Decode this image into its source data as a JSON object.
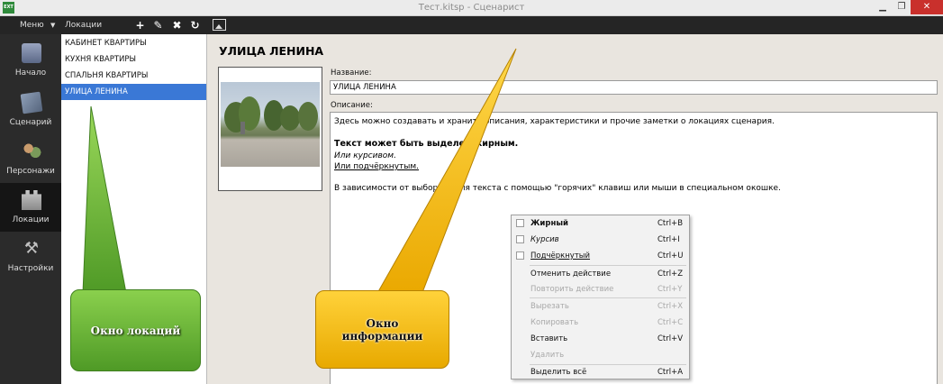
{
  "window": {
    "app_icon_text": "EXT",
    "title": "Тест.kitsp  - Сценарист",
    "min_glyph": "▁",
    "max_glyph": "❐",
    "close_glyph": "✕"
  },
  "menubar": {
    "menu_label": "Меню",
    "menu_caret": "▼",
    "panel_label": "Локации",
    "add_glyph": "+",
    "edit_glyph": "✎",
    "delete_glyph": "✖",
    "refresh_glyph": "↻"
  },
  "nav": {
    "items": [
      {
        "label": "Начало",
        "icon": "home-icon"
      },
      {
        "label": "Сценарий",
        "icon": "script-icon"
      },
      {
        "label": "Персонажи",
        "icon": "characters-icon"
      },
      {
        "label": "Локации",
        "icon": "locations-icon",
        "active": true
      },
      {
        "label": "Настройки",
        "icon": "settings-icon"
      }
    ],
    "tools_glyph": "⚒"
  },
  "locations": {
    "items": [
      "КАБИНЕТ КВАРТИРЫ",
      "КУХНЯ КВАРТИРЫ",
      "СПАЛЬНЯ КВАРТИРЫ",
      "УЛИЦА ЛЕНИНА"
    ],
    "selected": "УЛИЦА ЛЕНИНА"
  },
  "info": {
    "title": "УЛИЦА ЛЕНИНА",
    "name_label": "Название:",
    "name_value": "УЛИЦА ЛЕНИНА",
    "desc_label": "Описание:",
    "desc_lines": [
      "Здесь можно создавать и хранить описания, характеристики и прочие заметки о локациях сценария.",
      "Текст может быть выделен жирным.",
      "Или курсивом.",
      "Или подчёркнутым.",
      "В зависимости от выбора стиля текста с помощью \"горячих\" клавиш или мыши в специальном окошке."
    ]
  },
  "context_menu": {
    "items": [
      {
        "label": "Жирный",
        "shortcut": "Ctrl+B",
        "enabled": true
      },
      {
        "label": "Курсив",
        "shortcut": "Ctrl+I",
        "enabled": true
      },
      {
        "label": "Подчёркнутый",
        "shortcut": "Ctrl+U",
        "enabled": true
      },
      {
        "label": "Отменить действие",
        "shortcut": "Ctrl+Z",
        "enabled": true
      },
      {
        "label": "Повторить действие",
        "shortcut": "Ctrl+Y",
        "enabled": false
      },
      {
        "label": "Вырезать",
        "shortcut": "Ctrl+X",
        "enabled": false
      },
      {
        "label": "Копировать",
        "shortcut": "Ctrl+C",
        "enabled": false
      },
      {
        "label": "Вставить",
        "shortcut": "Ctrl+V",
        "enabled": true
      },
      {
        "label": "Удалить",
        "shortcut": "",
        "enabled": false
      },
      {
        "label": "Выделить всё",
        "shortcut": "Ctrl+A",
        "enabled": true
      }
    ]
  },
  "callouts": {
    "locations_window": "Окно локаций",
    "info_window_line1": "Окно",
    "info_window_line2": "информации"
  },
  "colors": {
    "selection": "#3a78d6",
    "close_button": "#c9302c",
    "callout_green": "#5fae2e",
    "callout_yellow": "#f5bd10"
  }
}
